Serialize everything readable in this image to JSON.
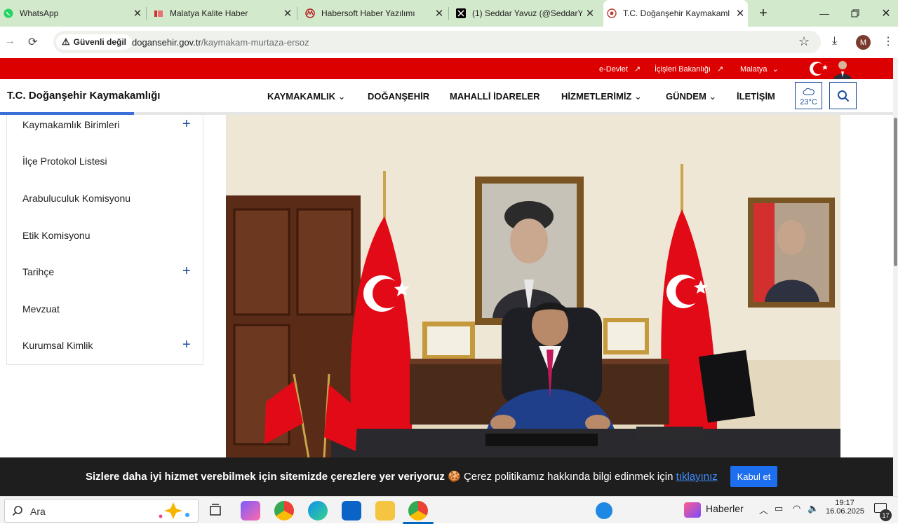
{
  "browser": {
    "tabs": [
      {
        "title": "WhatsApp",
        "icon": "whatsapp-icon",
        "color": "#25d366"
      },
      {
        "title": "Malatya Kalite Haber",
        "icon": "malatya-kalite-icon",
        "color": "#d32f2f"
      },
      {
        "title": "Habersoft Haber Yazılımı",
        "icon": "habersoft-icon",
        "color": "#b71c1c"
      },
      {
        "title": "(1) Seddar Yavuz (@SeddarY",
        "icon": "x-icon",
        "color": "#000000"
      },
      {
        "title": "T.C. Doğanşehir Kaymakaml",
        "icon": "kaymakamlik-icon",
        "color": "#c0392b"
      }
    ],
    "new_tab": "+",
    "security_chip": "Güvenli değil",
    "url_domain": "dogansehir.gov.tr",
    "url_path": "/kaymakam-murtaza-ersoz",
    "profile_initial": "M"
  },
  "topbar": {
    "links": [
      "e-Devlet",
      "İçişleri Bakanlığı",
      "Malatya"
    ]
  },
  "header": {
    "brand": "T.C. Doğanşehir Kaymakamlığı",
    "menu": [
      "KAYMAKAMLIK",
      "DOĞANŞEHİR",
      "MAHALLİ İDARELER",
      "HİZMETLERİMİZ",
      "GÜNDEM",
      "İLETİŞİM"
    ],
    "weather": "23°C"
  },
  "sidebar": {
    "items": [
      {
        "label": "Kaymakamlık Birimleri",
        "expandable": true
      },
      {
        "label": "İlçe Protokol Listesi",
        "expandable": false
      },
      {
        "label": "Arabuluculuk Komisyonu",
        "expandable": false
      },
      {
        "label": "Etik Komisyonu",
        "expandable": false
      },
      {
        "label": "Tarihçe",
        "expandable": true
      },
      {
        "label": "Mevzuat",
        "expandable": false
      },
      {
        "label": "Kurumsal Kimlik",
        "expandable": true
      }
    ],
    "expand_symbol": "+"
  },
  "progress": {
    "fraction": 0.15
  },
  "cookie": {
    "bold_text": "Sizlere daha iyi hizmet verebilmek için sitemizde çerezlere yer veriyoruz",
    "emoji": "🍪",
    "text": "Çerez politikamız hakkında bilgi edinmek için",
    "link": "tıklayınız",
    "button": "Kabul et"
  },
  "taskbar": {
    "search_placeholder": "Ara",
    "news_label": "Haberler",
    "time": "19:17",
    "date": "16.06.2025",
    "notification_count": "17"
  },
  "colors": {
    "accent_red": "#dd0000",
    "nav_blue": "#1a4c9c",
    "tab_bar": "#d3e9cc",
    "cookie_bg": "#1e1e1e",
    "cookie_button": "#1d6ff0"
  }
}
